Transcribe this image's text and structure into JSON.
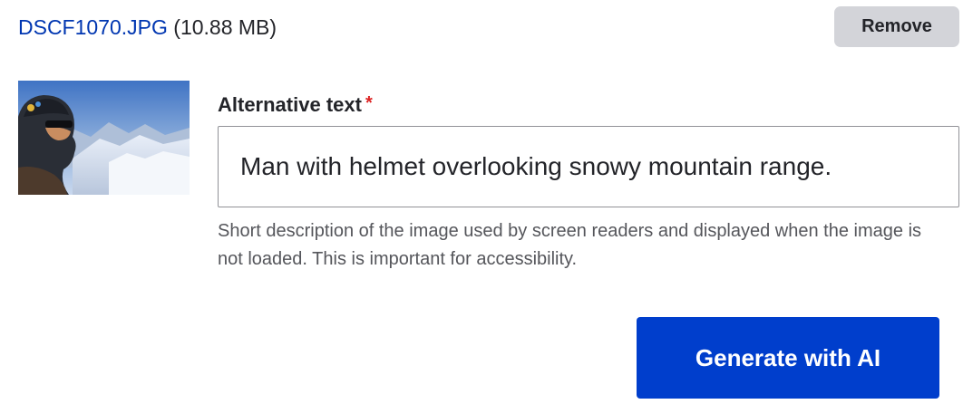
{
  "file": {
    "name": "DSCF1070.JPG",
    "size": "(10.88 MB)"
  },
  "remove_button": {
    "label": "Remove"
  },
  "thumbnail": {
    "icon": "image-thumbnail"
  },
  "alt_text": {
    "label": "Alternative text",
    "required_marker": "*",
    "value": "Man with helmet overlooking snowy mountain range.",
    "help": "Short description of the image used by screen readers and displayed when the image is not loaded. This is important for accessibility."
  },
  "generate_button": {
    "label": "Generate with AI"
  },
  "colors": {
    "link": "#0036b1",
    "primary_button": "#003ecc",
    "secondary_button": "#d3d4d9",
    "required": "#dc2323",
    "help_text": "#55565b"
  }
}
